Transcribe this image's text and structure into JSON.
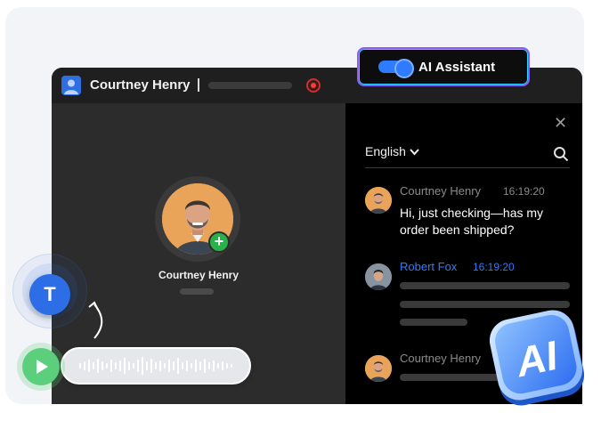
{
  "window": {
    "caller_name": "Courtney Henry"
  },
  "caller": {
    "name": "Courtney Henry"
  },
  "ai_assistant": {
    "label": "AI Assistant",
    "enabled": true,
    "badge_text": "AI"
  },
  "panel": {
    "language": "English",
    "close_icon": "close-icon",
    "search_icon": "search-icon"
  },
  "messages": [
    {
      "sender": "Courtney Henry",
      "time": "16:19:20",
      "text": "Hi, just checking—has my order been shipped?"
    },
    {
      "sender": "Robert Fox",
      "time": "16:19:20"
    },
    {
      "sender": "Courtney Henry"
    }
  ],
  "floating": {
    "t_button": "T"
  },
  "colors": {
    "accent_blue": "#2f7bff",
    "agent_name_blue": "#2f7bff",
    "record_red": "#ff3c3c",
    "add_green": "#29b14a",
    "play_green": "#5ccf7d"
  }
}
